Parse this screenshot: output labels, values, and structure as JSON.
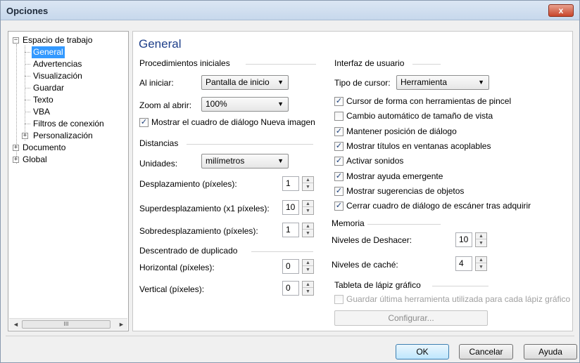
{
  "window": {
    "title": "Opciones",
    "close_label": "x"
  },
  "tree": {
    "items": [
      {
        "label": "Espacio de trabajo",
        "expander": "−"
      },
      {
        "label": "General"
      },
      {
        "label": "Advertencias"
      },
      {
        "label": "Visualización"
      },
      {
        "label": "Guardar"
      },
      {
        "label": "Texto"
      },
      {
        "label": "VBA"
      },
      {
        "label": "Filtros de conexión"
      },
      {
        "label": "Personalización",
        "expander": "+"
      },
      {
        "label": "Documento",
        "expander": "+"
      },
      {
        "label": "Global",
        "expander": "+"
      }
    ],
    "scroll_left": "◄",
    "scroll_right": "►",
    "scroll_grip": "III"
  },
  "content": {
    "heading": "General",
    "startup": {
      "title": "Procedimientos iniciales",
      "on_start_label": "Al iniciar:",
      "on_start_value": "Pantalla de inicio",
      "zoom_label": "Zoom al abrir:",
      "zoom_value": "100%",
      "show_new_image_dialog": "Mostrar el cuadro de diálogo Nueva imagen"
    },
    "distances": {
      "title": "Distancias",
      "units_label": "Unidades:",
      "units_value": "milímetros",
      "nudge_label": "Desplazamiento (píxeles):",
      "nudge_value": "1",
      "super_nudge_label": "Superdesplazamiento (x1 píxeles):",
      "super_nudge_value": "10",
      "sub_nudge_label": "Sobredesplazamiento (píxeles):",
      "sub_nudge_value": "1"
    },
    "duplicate": {
      "title": "Descentrado de duplicado",
      "horizontal_label": "Horizontal (píxeles):",
      "horizontal_value": "0",
      "vertical_label": "Vertical (píxeles):",
      "vertical_value": "0"
    },
    "ui": {
      "title": "Interfaz de usuario",
      "cursor_label": "Tipo de cursor:",
      "cursor_value": "Herramienta",
      "checkboxes": [
        {
          "label": "Cursor de forma con herramientas de pincel",
          "checked": true
        },
        {
          "label": "Cambio automático de tamaño de vista",
          "checked": false
        },
        {
          "label": "Mantener posición de diálogo",
          "checked": true
        },
        {
          "label": "Mostrar títulos en ventanas acoplables",
          "checked": true
        },
        {
          "label": "Activar sonidos",
          "checked": true
        },
        {
          "label": "Mostrar ayuda emergente",
          "checked": true
        },
        {
          "label": "Mostrar sugerencias de objetos",
          "checked": true
        },
        {
          "label": "Cerrar cuadro de diálogo de escáner tras adquirir",
          "checked": true
        }
      ]
    },
    "memory": {
      "title": "Memoria",
      "undo_label": "Niveles de Deshacer:",
      "undo_value": "10",
      "cache_label": "Niveles de caché:",
      "cache_value": "4"
    },
    "tablet": {
      "title": "Tableta de lápiz gráfico",
      "save_last_tool": "Guardar última herramienta utilizada para cada lápiz gráfico",
      "configure_button": "Configurar..."
    }
  },
  "buttons": {
    "ok": "OK",
    "cancel": "Cancelar",
    "help": "Ayuda"
  },
  "glyphs": {
    "check": "✓",
    "caret_down": "▼",
    "spin_up": "▲",
    "spin_down": "▼"
  }
}
